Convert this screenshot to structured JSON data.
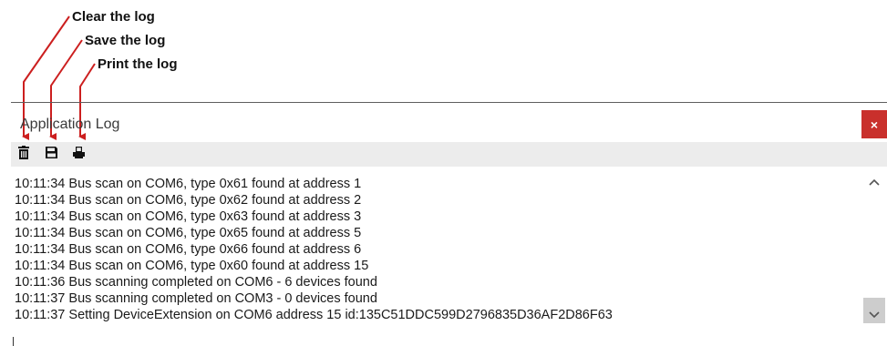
{
  "callouts": {
    "clear": "Clear the log",
    "save": "Save the log",
    "print": "Print the log"
  },
  "panel": {
    "title": "Application Log",
    "close_label": "×"
  },
  "toolbar": {
    "icons": [
      "trash-icon",
      "floppy-disk-icon",
      "printer-icon"
    ]
  },
  "log": {
    "lines": [
      "10:11:34 Bus scan on COM6, type 0x61 found at address 1",
      "10:11:34 Bus scan on COM6, type 0x62 found at address 2",
      "10:11:34 Bus scan on COM6, type 0x63 found at address 3",
      "10:11:34 Bus scan on COM6, type 0x65 found at address 5",
      "10:11:34 Bus scan on COM6, type 0x66 found at address 6",
      "10:11:34 Bus scan on COM6, type 0x60 found at address 15",
      "10:11:36 Bus scanning completed on COM6 - 6 devices found",
      "10:11:37 Bus scanning completed on COM3 - 0 devices found",
      "10:11:37 Setting DeviceExtension on COM6 address 15 id:135C51DDC599D2796835D36AF2D86F63"
    ]
  },
  "colors": {
    "arrow": "#cc1f1f",
    "close_button": "#c9302c"
  }
}
